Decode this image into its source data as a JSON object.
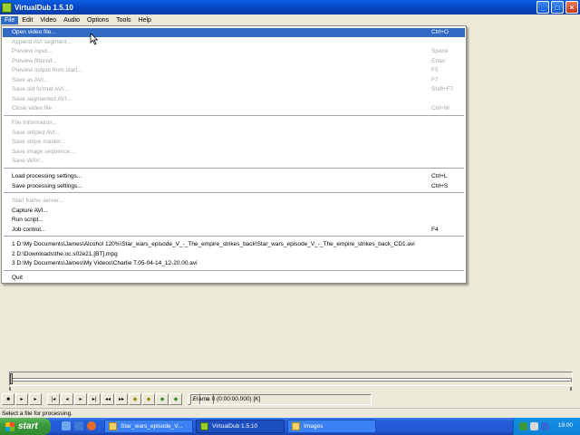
{
  "window": {
    "title": "VirtualDub 1.5.10"
  },
  "menubar": {
    "items": [
      {
        "label": "File",
        "active": true
      },
      {
        "label": "Edit"
      },
      {
        "label": "Video"
      },
      {
        "label": "Audio"
      },
      {
        "label": "Options"
      },
      {
        "label": "Tools"
      },
      {
        "label": "Help"
      }
    ]
  },
  "file_menu": {
    "items": [
      {
        "label": "Open video file...",
        "shortcut": "Ctrl+O",
        "enabled": true,
        "highlighted": true
      },
      {
        "label": "Append AVI segment...",
        "shortcut": "",
        "enabled": false
      },
      {
        "label": "Preview input...",
        "shortcut": "Space",
        "enabled": false
      },
      {
        "label": "Preview filtered...",
        "shortcut": "Enter",
        "enabled": false
      },
      {
        "label": "Preview output from start...",
        "shortcut": "F5",
        "enabled": false
      },
      {
        "label": "Save as AVI...",
        "shortcut": "F7",
        "enabled": false
      },
      {
        "label": "Save old format AVI...",
        "shortcut": "Shift+F7",
        "enabled": false
      },
      {
        "label": "Save segmented AVI...",
        "shortcut": "",
        "enabled": false
      },
      {
        "label": "Close video file",
        "shortcut": "Ctrl+W",
        "enabled": false
      },
      {
        "label": "File Information...",
        "shortcut": "",
        "enabled": false
      },
      {
        "label": "Save striped AVI...",
        "shortcut": "",
        "enabled": false
      },
      {
        "label": "Save stripe master...",
        "shortcut": "",
        "enabled": false
      },
      {
        "label": "Save image sequence...",
        "shortcut": "",
        "enabled": false
      },
      {
        "label": "Save WAV...",
        "shortcut": "",
        "enabled": false
      },
      {
        "label": "Load processing settings...",
        "shortcut": "Ctrl+L",
        "enabled": true
      },
      {
        "label": "Save processing settings...",
        "shortcut": "Ctrl+S",
        "enabled": true
      },
      {
        "label": "Start frame server...",
        "shortcut": "",
        "enabled": false
      },
      {
        "label": "Capture AVI...",
        "shortcut": "",
        "enabled": true
      },
      {
        "label": "Run script...",
        "shortcut": "",
        "enabled": true
      },
      {
        "label": "Job control...",
        "shortcut": "F4",
        "enabled": true
      },
      {
        "label": "1 D:\\My Documents\\James\\Alcohol 120%\\Star_wars_episode_V_-_The_empire_strikes_back\\Star_wars_episode_V_-_The_empire_strikes_back_CD1.avi",
        "shortcut": "",
        "enabled": true
      },
      {
        "label": "2 D:\\Downloads\\the.oc.s02e21.[BT].mpg",
        "shortcut": "",
        "enabled": true
      },
      {
        "label": "3 D:\\My Documents\\James\\My Videos\\Charlie T.05-04-14_12-20.00.avi",
        "shortcut": "",
        "enabled": true
      },
      {
        "label": "Quit",
        "shortcut": "",
        "enabled": true
      }
    ]
  },
  "position_panel": {
    "frame_text": "Frame 0 (0:00:00.000) [K]"
  },
  "status": {
    "text": "Select a file for processing."
  },
  "taskbar": {
    "start_label": "start",
    "tasks": [
      {
        "label": "Star_wars_episode_V...",
        "active": false
      },
      {
        "label": "VirtualDub 1.5.10",
        "active": true
      },
      {
        "label": "Images",
        "active": false
      }
    ],
    "clock": "19:00"
  },
  "colors": {
    "titlebar": "#0548c8",
    "highlight": "#316ac5",
    "disabled_text": "#a7a6aa",
    "taskbar": "#245edb",
    "start_button": "#3c9a3c"
  }
}
